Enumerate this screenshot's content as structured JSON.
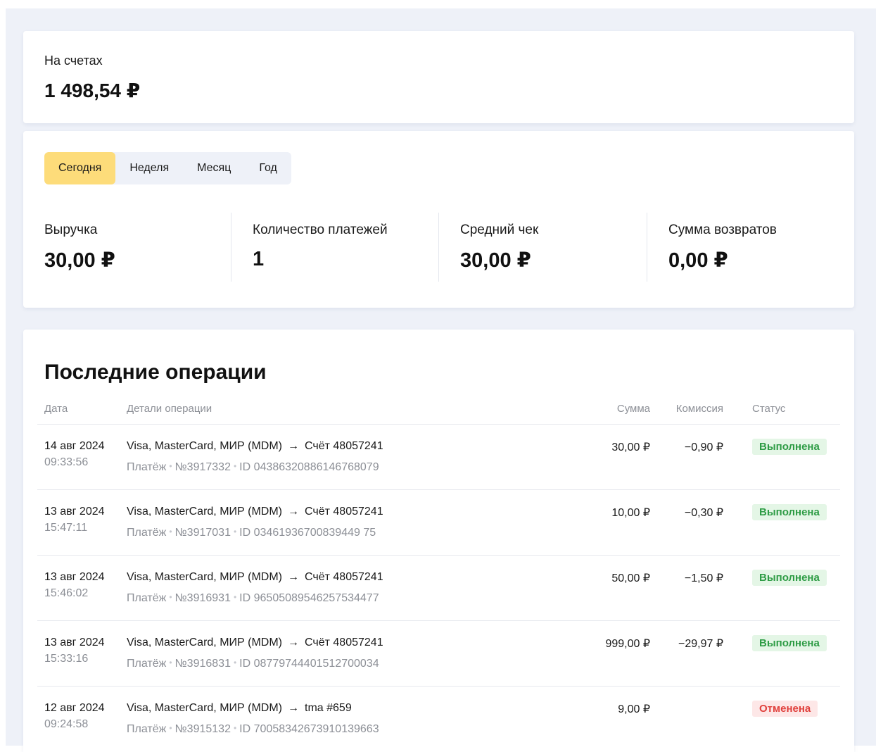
{
  "balance": {
    "label": "На счетах",
    "value": "1 498,54 ₽"
  },
  "periods": {
    "tabs": [
      "Сегодня",
      "Неделя",
      "Месяц",
      "Год"
    ],
    "selected": "Сегодня"
  },
  "stats": [
    {
      "label": "Выручка",
      "value": "30,00 ₽"
    },
    {
      "label": "Количество платежей",
      "value": "1"
    },
    {
      "label": "Средний чек",
      "value": "30,00 ₽"
    },
    {
      "label": "Сумма возвратов",
      "value": "0,00 ₽"
    }
  ],
  "operations": {
    "title": "Последние операции",
    "columns": {
      "date": "Дата",
      "details": "Детали операции",
      "amount": "Сумма",
      "fee": "Комиссия",
      "status": "Статус"
    },
    "arrow": "→",
    "rows": [
      {
        "date": "14 авг 2024",
        "time": "09:33:56",
        "source": "Visa, MasterCard, МИР (MDM)",
        "target": "Счёт 48057241",
        "type": "Платёж",
        "number": "№3917332",
        "id": "ID 04386320886146768079",
        "amount": "30,00 ₽",
        "fee": "−0,90 ₽",
        "status": "Выполнена"
      },
      {
        "date": "13 авг 2024",
        "time": "15:47:11",
        "source": "Visa, MasterCard, МИР (MDM)",
        "target": "Счёт 48057241",
        "type": "Платёж",
        "number": "№3917031",
        "id": "ID 03461936700839449 75",
        "amount": "10,00 ₽",
        "fee": "−0,30 ₽",
        "status": "Выполнена"
      },
      {
        "date": "13 авг 2024",
        "time": "15:46:02",
        "source": "Visa, MasterCard, МИР (MDM)",
        "target": "Счёт 48057241",
        "type": "Платёж",
        "number": "№3916931",
        "id": "ID 96505089546257534477",
        "amount": "50,00 ₽",
        "fee": "−1,50 ₽",
        "status": "Выполнена"
      },
      {
        "date": "13 авг 2024",
        "time": "15:33:16",
        "source": "Visa, MasterCard, МИР (MDM)",
        "target": "Счёт 48057241",
        "type": "Платёж",
        "number": "№3916831",
        "id": "ID 08779744401512700034",
        "amount": "999,00 ₽",
        "fee": "−29,97 ₽",
        "status": "Выполнена"
      },
      {
        "date": "12 авг 2024",
        "time": "09:24:58",
        "source": "Visa, MasterCard, МИР (MDM)",
        "target": "tma #659",
        "type": "Платёж",
        "number": "№3915132",
        "id": "ID 70058342673910139663",
        "amount": "9,00 ₽",
        "fee": "",
        "status": "Отменена"
      }
    ]
  },
  "colors": {
    "accent_tab": "#fddc7a",
    "status_done": "#2e9c45",
    "status_cancelled": "#e0403c",
    "page_bg": "#eef1f8"
  }
}
